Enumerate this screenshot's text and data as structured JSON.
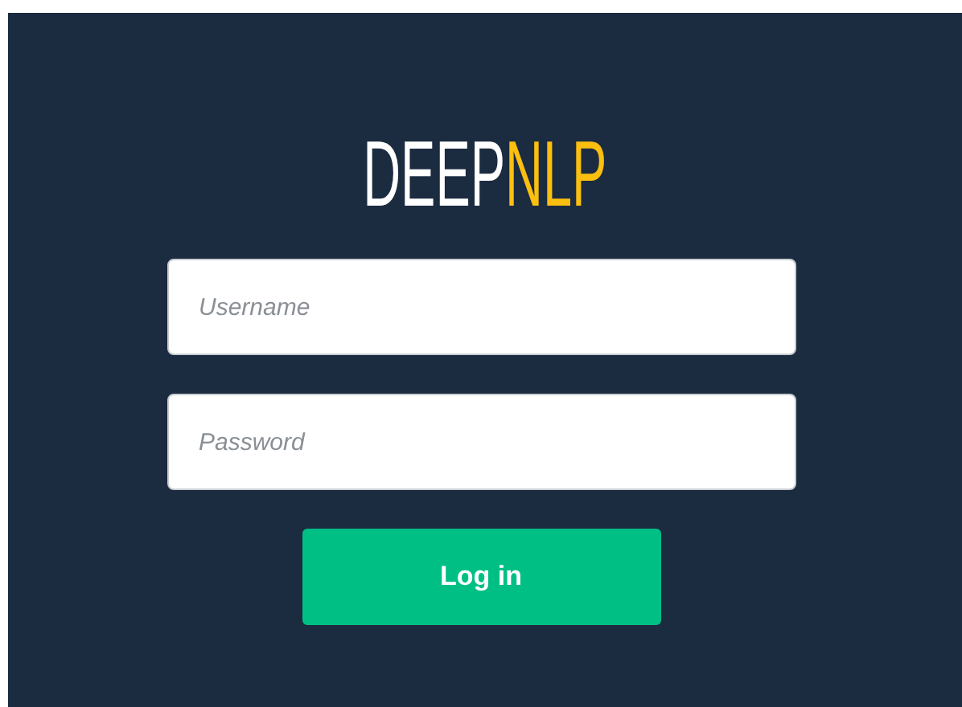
{
  "logo": [
    {
      "text": "DEEP",
      "color": "#ffffff"
    },
    {
      "text": "NLP",
      "color": "#fbbf10"
    }
  ],
  "fields": [
    {
      "placeholder": "Username"
    },
    {
      "placeholder": "Password"
    }
  ],
  "login_button": {
    "label": "Log in"
  }
}
